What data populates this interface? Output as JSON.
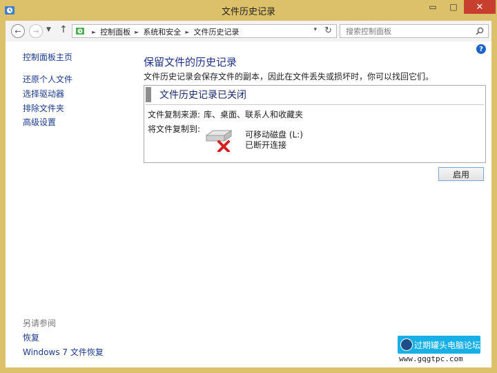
{
  "window": {
    "title": "文件历史记录",
    "minimize_glyph": "▭",
    "maximize_glyph": "□",
    "close_glyph": "✕"
  },
  "nav": {
    "back_glyph": "←",
    "forward_glyph": "→",
    "recent_glyph": "▼",
    "up_glyph": "↑"
  },
  "address": {
    "crumbs": [
      "控制面板",
      "系统和安全",
      "文件历史记录"
    ],
    "separator": "►",
    "dropdown_glyph": "▾",
    "refresh_glyph": "↻"
  },
  "search": {
    "placeholder": "搜索控制面板"
  },
  "help": {
    "glyph": "?"
  },
  "sidebar": {
    "items": [
      {
        "label": "控制面板主页"
      },
      {
        "label": "还原个人文件"
      },
      {
        "label": "选择驱动器"
      },
      {
        "label": "排除文件夹"
      },
      {
        "label": "高级设置"
      }
    ],
    "see_also_label": "另请参阅",
    "see_also_items": [
      {
        "label": "恢复"
      },
      {
        "label": "Windows 7 文件恢复"
      }
    ]
  },
  "main": {
    "heading": "保留文件的历史记录",
    "description": "文件历史记录会保存文件的副本，因此在文件丢失或损坏时，你可以找回它们。",
    "panel": {
      "title": "文件历史记录已关闭",
      "source_label": "文件复制来源:",
      "source_value": "库、桌面、联系人和收藏夹",
      "dest_label": "将文件复制到:",
      "drive_name": "可移动磁盘 (L:)",
      "drive_status": "已断开连接"
    },
    "enable_button": "启用"
  },
  "watermark": {
    "text": "过期罐头电脑论坛",
    "url": "www.gqgtpc.com"
  },
  "colors": {
    "frame": "#dcc06a",
    "link": "#1a3a8a",
    "heading": "#1e3287",
    "close": "#c7402f"
  }
}
